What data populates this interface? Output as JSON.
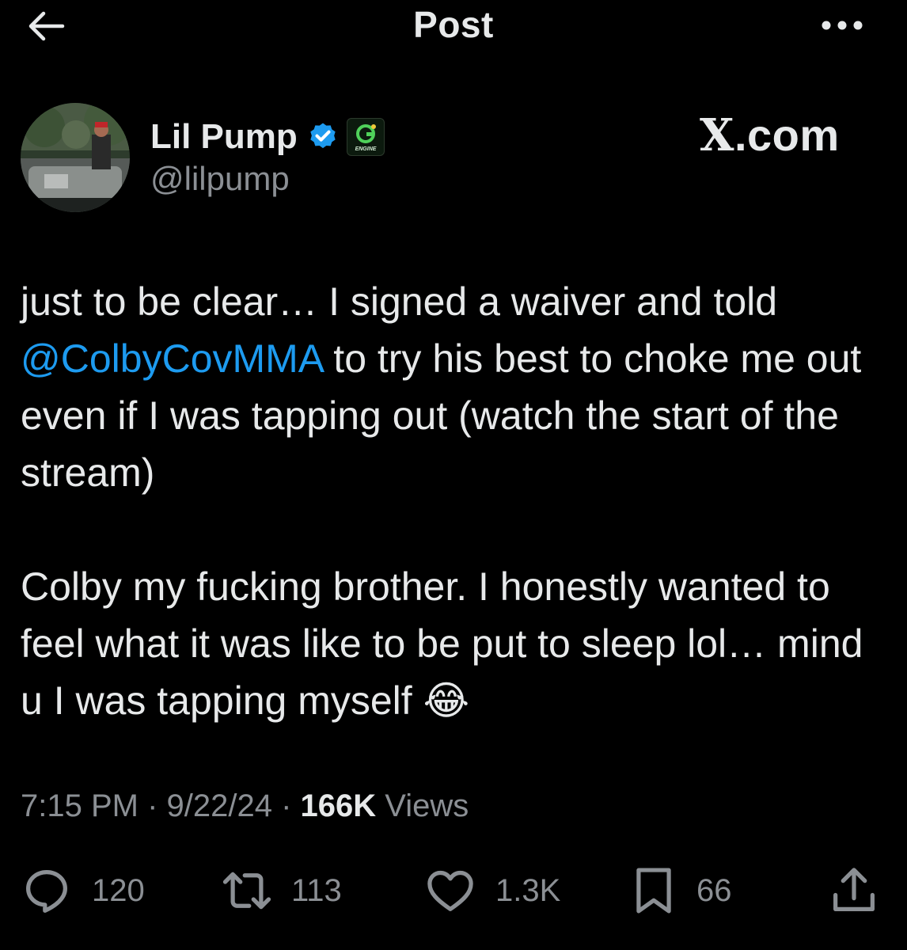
{
  "header": {
    "title": "Post",
    "back_icon": "arrow-left-icon",
    "more_icon": "more-horizontal-icon"
  },
  "author": {
    "display_name": "Lil Pump",
    "handle": "@lilpump",
    "verified_icon": "verified-badge-icon",
    "affiliate_badge_text": "ENGINE",
    "verified_color": "#1d9bf0"
  },
  "watermark": {
    "x": "X",
    "domain": ".com"
  },
  "post": {
    "paragraph1_line1": "just to be clear… I signed a waiver and told",
    "mention": "@ColbyCovMMA",
    "paragraph1_rest": " to try his best to choke me out even if I was tapping out (watch the start of the stream)",
    "paragraph2": "Colby my fucking brother. I honestly wanted to feel what it was like to be put to sleep lol… mind u I was tapping myself ",
    "emoji": "😂"
  },
  "meta": {
    "time": "7:15 PM",
    "separator": " · ",
    "date": "9/22/24",
    "views_count": "166K",
    "views_label": " Views"
  },
  "actions": {
    "replies": "120",
    "reposts": "113",
    "likes": "1.3K",
    "bookmarks": "66"
  },
  "colors": {
    "background": "#000000",
    "text": "#e7e9ea",
    "secondary_text": "#8b8f94",
    "link": "#1d9bf0"
  }
}
